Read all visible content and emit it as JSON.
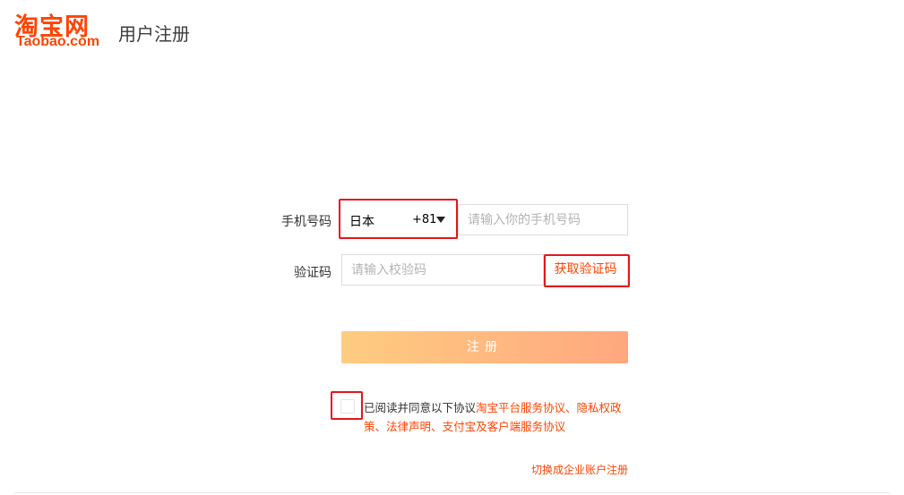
{
  "header": {
    "logo_cn": "淘宝网",
    "logo_en": "Taobao.com",
    "title": "用户注册"
  },
  "form": {
    "phone_label": "手机号码",
    "country_name": "日本",
    "country_code": "+81",
    "phone_placeholder": "请输入你的手机号码",
    "code_label": "验证码",
    "code_placeholder": "请输入校验码",
    "get_code_label": "获取验证码",
    "register_label": "注册"
  },
  "agreement": {
    "prefix": "已阅读并同意以下协议",
    "links": [
      "淘宝平台服务协议",
      "隐私权政策",
      "法律声明",
      "支付宝及客户端服务协议"
    ],
    "separator": "、"
  },
  "footer": {
    "switch_link": "切换成企业账户注册"
  },
  "colors": {
    "brand": "#ff4400",
    "highlight_box": "#e4161c",
    "button_gradient_start": "#ffcc80",
    "button_gradient_end": "#ffa77f"
  },
  "icons": {
    "country_dropdown": "caret-down-icon"
  }
}
